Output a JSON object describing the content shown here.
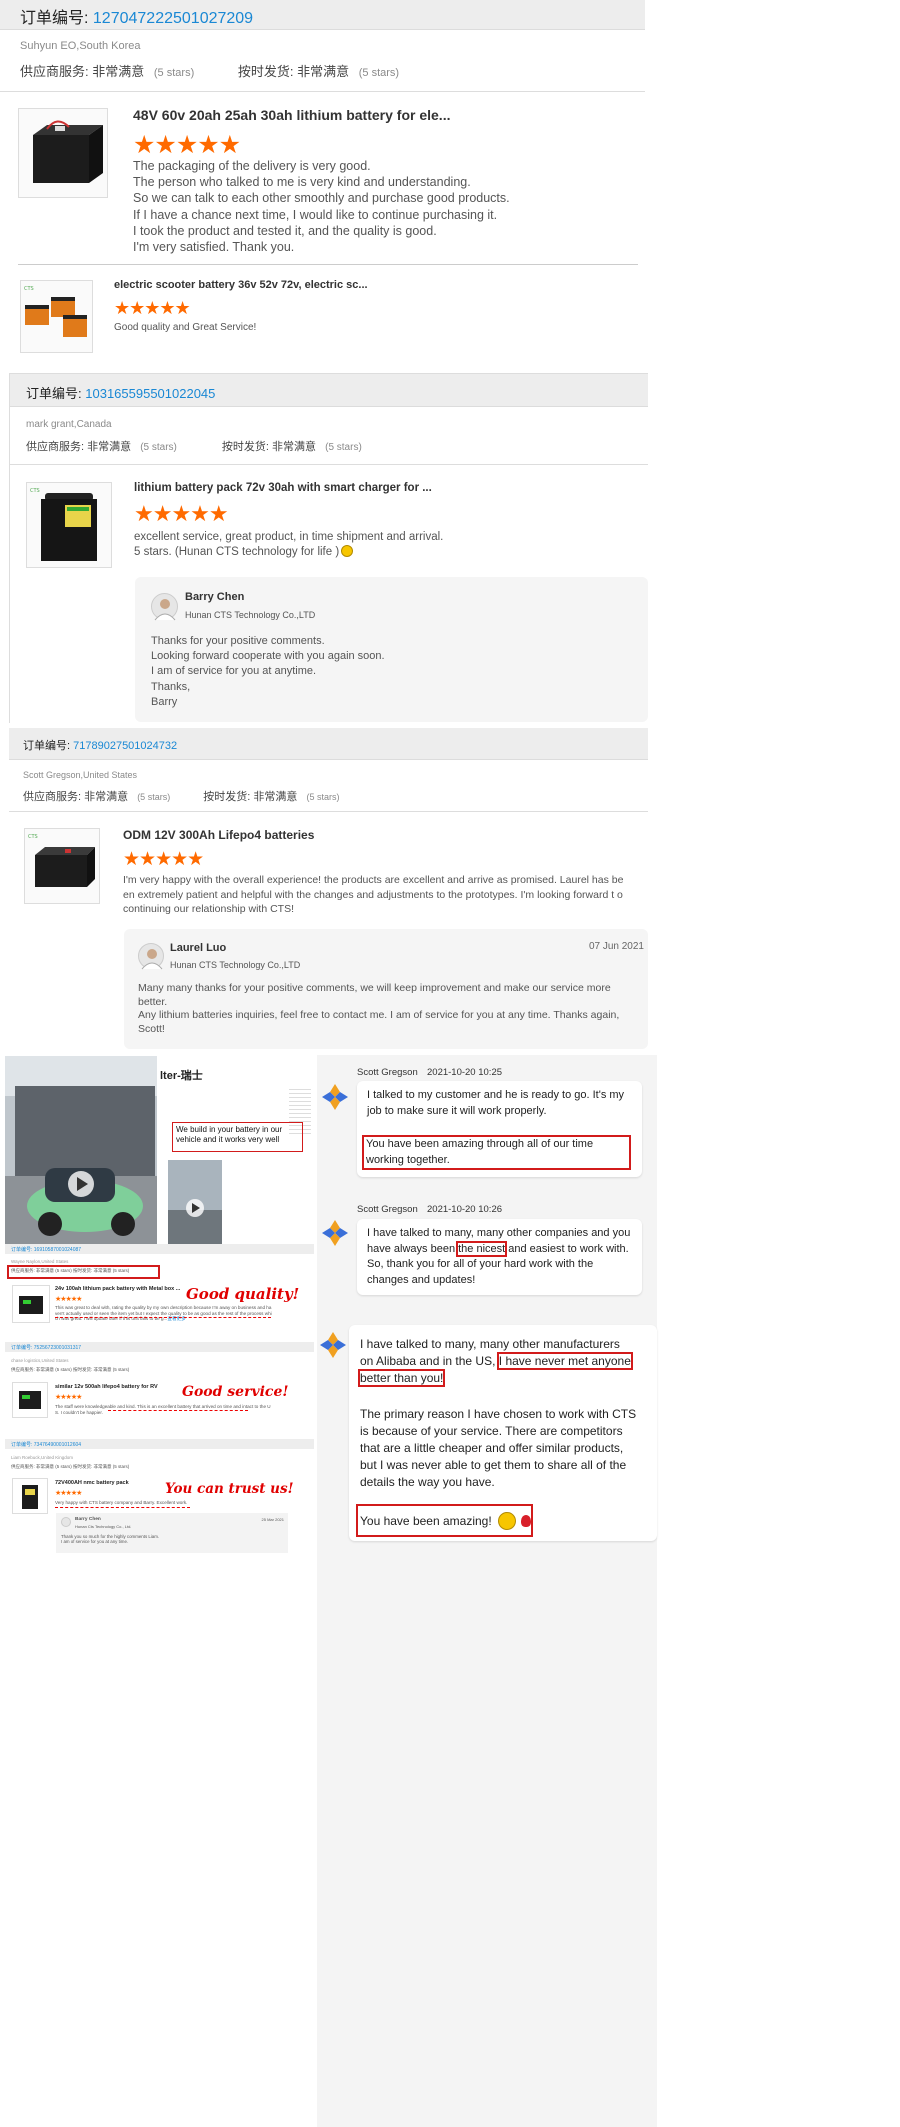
{
  "order1": {
    "label": "订单编号:",
    "number": "127047222501027209",
    "buyer": "Suhyun EO,South Korea",
    "supplier_label": "供应商服务:",
    "supplier_rating": "非常满意",
    "supplier_stars": "(5 stars)",
    "ship_label": "按时发货:",
    "ship_rating": "非常满意",
    "ship_stars": "(5 stars)",
    "product": "48V 60v 20ah 25ah 30ah lithium battery for ele...",
    "stars": "★★★★★",
    "review": [
      "The packaging of the delivery is very good.",
      "The person who talked to me is very kind and understanding.",
      "So we can talk to each other smoothly and purchase good products.",
      "If I have a chance next time, I would like to continue purchasing it.",
      "I took the product and tested it, and the quality is good.",
      "I'm very satisfied. Thank you."
    ]
  },
  "item2": {
    "product": "electric scooter battery 36v 52v 72v, electric sc...",
    "stars": "★★★★★",
    "review": "Good quality and Great Service!"
  },
  "order3": {
    "label": "订单编号:",
    "number": "103165595501022045",
    "buyer": "mark grant,Canada",
    "supplier_label": "供应商服务:",
    "supplier_rating": "非常满意",
    "supplier_stars": "(5 stars)",
    "ship_label": "按时发货:",
    "ship_rating": "非常满意",
    "ship_stars": "(5 stars)",
    "product": "lithium battery pack 72v 30ah with smart charger for ...",
    "stars": "★★★★★",
    "review": [
      "excellent service, great product, in time shipment and arrival.",
      "5 stars. (Hunan CTS technology for life )"
    ],
    "reply": {
      "name": "Barry Chen",
      "company": "Hunan CTS Technology Co.,LTD",
      "lines": [
        "Thanks for your positive comments.",
        "Looking forward cooperate with you again soon.",
        "I am of service for you at anytime.",
        "Thanks,",
        "Barry"
      ]
    }
  },
  "order4": {
    "label": "订单编号:",
    "number": "71789027501024732",
    "buyer": "Scott Gregson,United States",
    "supplier_label": "供应商服务:",
    "supplier_rating": "非常满意",
    "supplier_stars": "(5 stars)",
    "ship_label": "按时发货:",
    "ship_rating": "非常满意",
    "ship_stars": "(5 stars)",
    "product": "ODM 12V 300Ah Lifepo4 batteries",
    "stars": "★★★★★",
    "review": "I'm very happy with the overall experience! the products are excellent and arrive as promised. Laurel has be en extremely patient and helpful with the changes and adjustments to the prototypes. I'm looking forward t o continuing our relationship with CTS!",
    "reply": {
      "name": "Laurel Luo",
      "company": "Hunan CTS Technology Co.,LTD",
      "date": "07 Jun 2021",
      "lines": [
        "Many many thanks for your positive comments, we will keep improvement and make our service more better.",
        "Any lithium batteries inquiries, feel free to contact me. I am of service for you at any time. Thanks again, Scott!"
      ]
    }
  },
  "collage": {
    "header_fragment": "lter-瑞士",
    "callout": "We build in your battery in our vehicle and it works very well",
    "good_quality": "Good quality!",
    "good_service": "Good service!",
    "trust": "You can trust us!",
    "mini1": {
      "order": "订单编号: 16910587001024087",
      "buyer": "Wayne Naylon,United States",
      "ratings": "供应商服务: 非常满意 (5 stars)    按时发货: 非常满意 (5 stars)",
      "product": "24v 100ah lithium pack battery with Metal box ...",
      "text": "This was great to deal with, rating the quality by my own description because I'm away on business and ha ven't actually used or seen the item yet but I expect the quality to be as good as the rest of the process whi ch was great. I will update later if this unit fails to be g...",
      "more": "查看更多"
    },
    "mini2": {
      "order": "订单编号: 75256723001031317",
      "buyer": "chase logistics,United States",
      "ratings": "供应商服务: 非常满意 (5 stars)    按时发货: 非常满意 (5 stars)",
      "product": "similar 12v 500ah lifepo4 battery for RV",
      "text": "The staff were knowledgeable and kind. This is an excellent battery that arrived on time and intact to the U S. I couldn't be happier."
    },
    "mini3": {
      "order": "订单编号: 73476490001012604",
      "buyer": "Liam Roebuck,United Kingdom",
      "ratings": "供应商服务: 非常满意 (5 stars)    按时发货: 非常满意 (5 stars)",
      "product": "72V400AH nmc battery pack",
      "text": "Very happy with CTS battery company and Barry. Excellent work.",
      "reply_name": "Barry Chen",
      "reply_company": "Hunan Cts Technology Co., Ltd.",
      "reply_date": "25 Mar 2021",
      "reply_lines": [
        "Thank you so much for the highly comments Liam.",
        "I am of service for you at any time."
      ]
    }
  },
  "chat": {
    "m1": {
      "name": "Scott Gregson",
      "time": "2021-10-20 10:25",
      "text": "I talked to my customer and he is ready to go. It's my job to make sure it will work properly.",
      "highlight": "You have been amazing through all of our time working together."
    },
    "m2": {
      "name": "Scott Gregson",
      "time": "2021-10-20 10:26",
      "pre": "I have talked to many, many other companies and you have always been ",
      "highlight": "the nicest",
      "post": " and easiest to work with. So, thank you for all of your hard work with the changes and updates!"
    },
    "m3": {
      "pre": "I have talked to many, many other manufacturers on Alibaba and in the US, ",
      "highlight": "I have never met anyone better than you!",
      "p2": "The primary reason I have chosen to work with CTS is because of your service. There are competitors that are a little cheaper and offer similar products, but I was never able to get them to share all of the details the way you have.",
      "final": "You have been amazing!"
    }
  }
}
